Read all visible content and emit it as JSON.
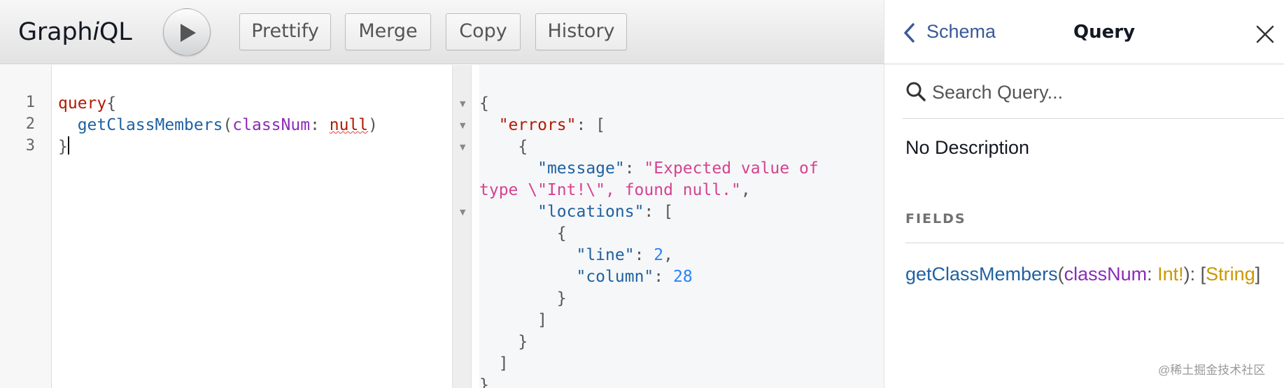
{
  "app": {
    "title_prefix": "Graph",
    "title_italic": "i",
    "title_suffix": "QL"
  },
  "toolbar": {
    "run_icon": "play-icon",
    "buttons": [
      {
        "label": "Prettify"
      },
      {
        "label": "Merge"
      },
      {
        "label": "Copy"
      },
      {
        "label": "History"
      }
    ]
  },
  "editor": {
    "line_numbers": [
      "1",
      "2",
      "3"
    ],
    "line1": {
      "keyword": "query",
      "brace": "{"
    },
    "line2": {
      "field": "getClassMembers",
      "open": "(",
      "arg": "classNum",
      "colon": ": ",
      "value": "null",
      "close": ")"
    },
    "line3": {
      "brace": "}"
    }
  },
  "result": {
    "lines": {
      "l1": "{",
      "errors_key": "\"errors\"",
      "errors_rest": ": [",
      "l3": "{",
      "message_key": "\"message\"",
      "message_colon": ": ",
      "message_val_a": "\"Expected value of",
      "message_val_b": "type \\\"Int!\\\", found null.\"",
      "comma": ",",
      "locations_key": "\"locations\"",
      "locations_rest": ": [",
      "l7": "{",
      "line_key": "\"line\"",
      "line_colon": ": ",
      "line_val": "2",
      "column_key": "\"column\"",
      "column_colon": ": ",
      "column_val": "28",
      "close_obj": "}",
      "close_arr": "]",
      "close_obj2": "}",
      "close_arr2": "]",
      "close_root": "}"
    }
  },
  "docs": {
    "back_label": "Schema",
    "title": "Query",
    "search_placeholder": "Search Query...",
    "description": "No Description",
    "fields_heading": "FIELDS",
    "field": {
      "name": "getClassMembers",
      "open": "(",
      "arg": "classNum",
      "colon": ": ",
      "arg_type": "Int!",
      "close": "): ",
      "ret_open": "[",
      "ret_type": "String",
      "ret_close": "]"
    }
  },
  "watermark": "@稀土掘金技术社区",
  "colors": {
    "keyword": "#b11a04",
    "field": "#1f61a0",
    "argument": "#8b2bb9",
    "string": "#d64292",
    "number": "#2882f9",
    "type": "#CA9800",
    "link": "#3B5998"
  }
}
